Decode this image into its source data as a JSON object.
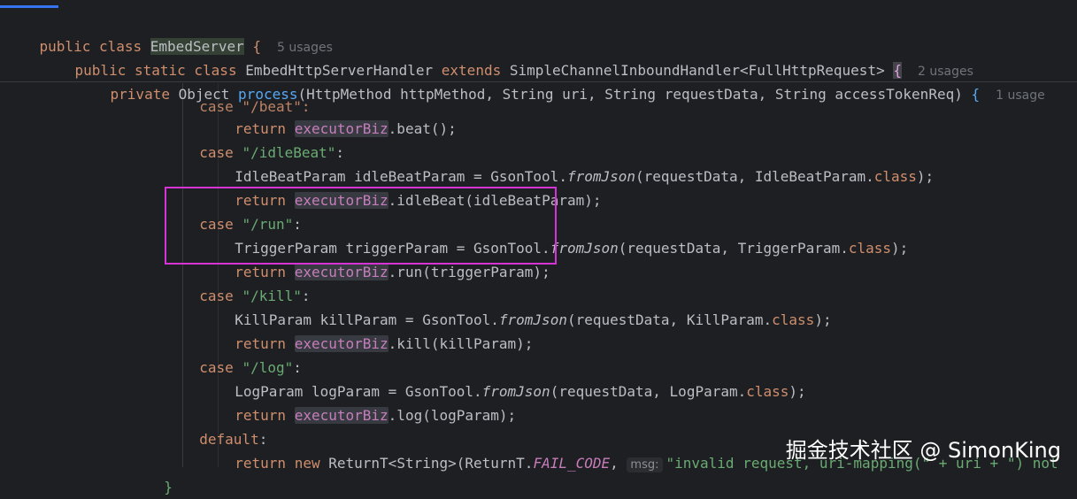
{
  "sticky": {
    "line1": {
      "kw1": "public",
      "kw2": "class",
      "name": "EmbedServer",
      "brace": "{",
      "hint": "5 usages"
    },
    "line2": {
      "kw1": "public",
      "kw2": "static",
      "kw3": "class",
      "name": "EmbedHttpServerHandler",
      "kw4": "extends",
      "parent": "SimpleChannelInboundHandler<FullHttpRequest>",
      "brace": "{",
      "hint": "2 usages"
    },
    "line3": {
      "kw1": "private",
      "type": "Object",
      "fn": "process",
      "sig": "(HttpMethod httpMethod, String uri, String requestData, String accessTokenReq)",
      "brace": "{",
      "hint": "1 usage"
    }
  },
  "code": {
    "partial_case": "case \"/beat\":",
    "beat_ret": {
      "kw": "return",
      "field": "executorBiz",
      "rest": ".beat();"
    },
    "case_idle": {
      "kw": "case",
      "str": "\"/idleBeat\"",
      "colon": ":"
    },
    "idle_decl": {
      "pre": "IdleBeatParam idleBeatParam = GsonTool.",
      "fn": "fromJson",
      "mid": "(requestData, IdleBeatParam.",
      "kw": "class",
      "post": ");"
    },
    "idle_ret": {
      "kw": "return",
      "field": "executorBiz",
      "rest": ".idleBeat(idleBeatParam);"
    },
    "case_run": {
      "kw": "case",
      "str": "\"/run\"",
      "colon": ":"
    },
    "run_decl": {
      "pre": "TriggerParam triggerParam = GsonTool.",
      "fn": "fromJson",
      "mid": "(requestData, TriggerParam.",
      "kw": "class",
      "post": ");"
    },
    "run_ret": {
      "kw": "return",
      "field": "executorBiz",
      "rest": ".run(triggerParam);"
    },
    "case_kill": {
      "kw": "case",
      "str": "\"/kill\"",
      "colon": ":"
    },
    "kill_decl": {
      "pre": "KillParam killParam = GsonTool.",
      "fn": "fromJson",
      "mid": "(requestData, KillParam.",
      "kw": "class",
      "post": ");"
    },
    "kill_ret": {
      "kw": "return",
      "field": "executorBiz",
      "rest": ".kill(killParam);"
    },
    "case_log": {
      "kw": "case",
      "str": "\"/log\"",
      "colon": ":"
    },
    "log_decl": {
      "pre": "LogParam logParam = GsonTool.",
      "fn": "fromJson",
      "mid": "(requestData, LogParam.",
      "kw": "class",
      "post": ");"
    },
    "log_ret": {
      "kw": "return",
      "field": "executorBiz",
      "rest": ".log(logParam);"
    },
    "default": {
      "kw": "default",
      "colon": ":"
    },
    "default_ret": {
      "kw1": "return",
      "kw2": "new",
      "pre": "ReturnT<String>(ReturnT.",
      "const": "FAIL_CODE",
      "comma": ",",
      "inlay": "msg:",
      "str": "\"invalid request, uri-mapping(\" + uri + \") not"
    },
    "close_brace": "}"
  },
  "watermark": "掘金技术社区 @ SimonKing",
  "colors": {
    "background": "#1e1f22",
    "keyword": "#cf8e6d",
    "string": "#6aab73",
    "field": "#c77dbb",
    "function": "#56a8f5",
    "highlight_box": "#d633d6"
  }
}
